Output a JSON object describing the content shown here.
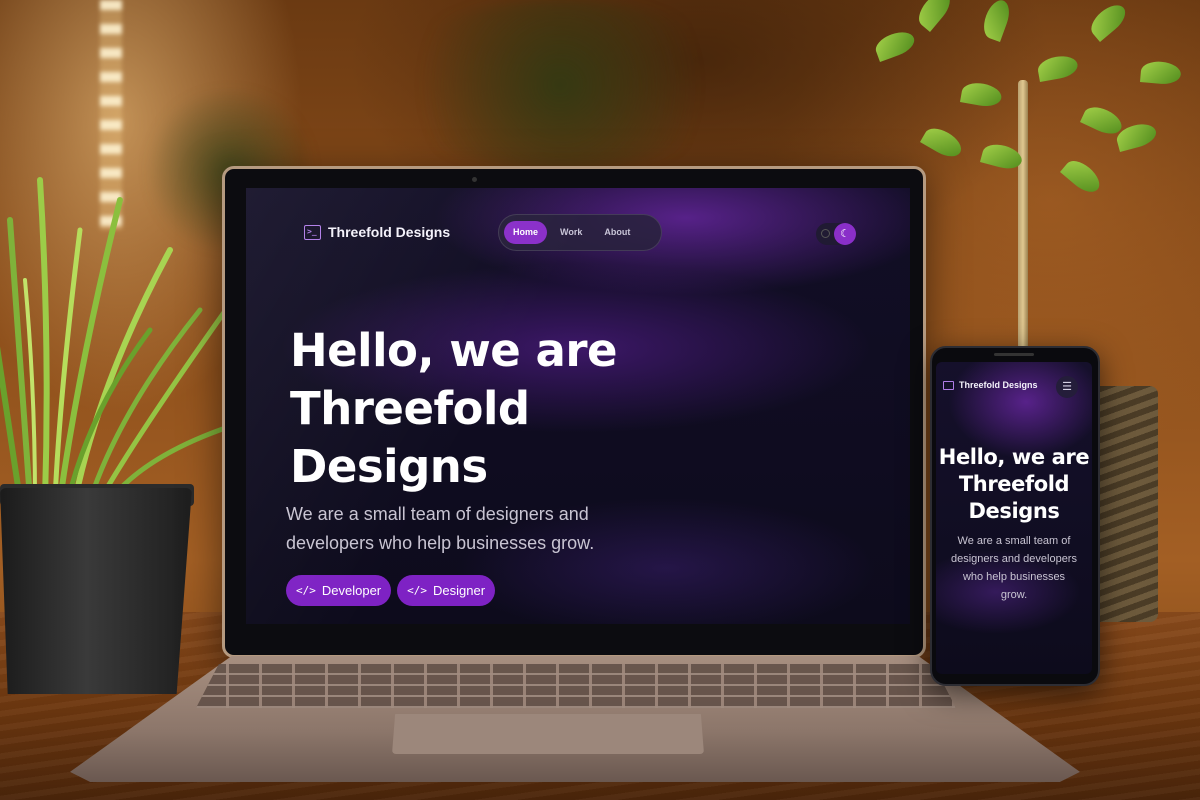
{
  "colors": {
    "accent": "#8a2fc9",
    "button": "#7e22c4",
    "screen_background": "#0d0b1c",
    "brand_icon": "#b07ce8"
  },
  "laptop_site": {
    "brand": {
      "icon": "terminal-icon",
      "name": "Threefold Designs"
    },
    "nav": {
      "items": [
        {
          "label": "Home",
          "active": true
        },
        {
          "label": "Work",
          "active": false
        },
        {
          "label": "About",
          "active": false
        }
      ]
    },
    "theme_toggle": {
      "icon": "moon-icon",
      "state": "dark"
    },
    "hero": {
      "title_lines": [
        "Hello, we are",
        "Threefold",
        "Designs"
      ],
      "subtitle_lines": [
        "We are a small team of designers and",
        "developers who help businesses grow."
      ]
    },
    "buttons": [
      {
        "icon": "code-icon",
        "glyph": "</>",
        "label": "Developer"
      },
      {
        "icon": "code-icon",
        "glyph": "</>",
        "label": "Designer"
      }
    ]
  },
  "phone_site": {
    "brand": {
      "icon": "terminal-icon",
      "name": "Threefold Designs"
    },
    "menu": {
      "icon": "hamburger-menu-icon"
    },
    "hero": {
      "title_lines": [
        "Hello, we are",
        "Threefold",
        "Designs"
      ],
      "subtitle_lines": [
        "We are a small team of",
        "designers and developers",
        "who help businesses grow."
      ]
    }
  }
}
